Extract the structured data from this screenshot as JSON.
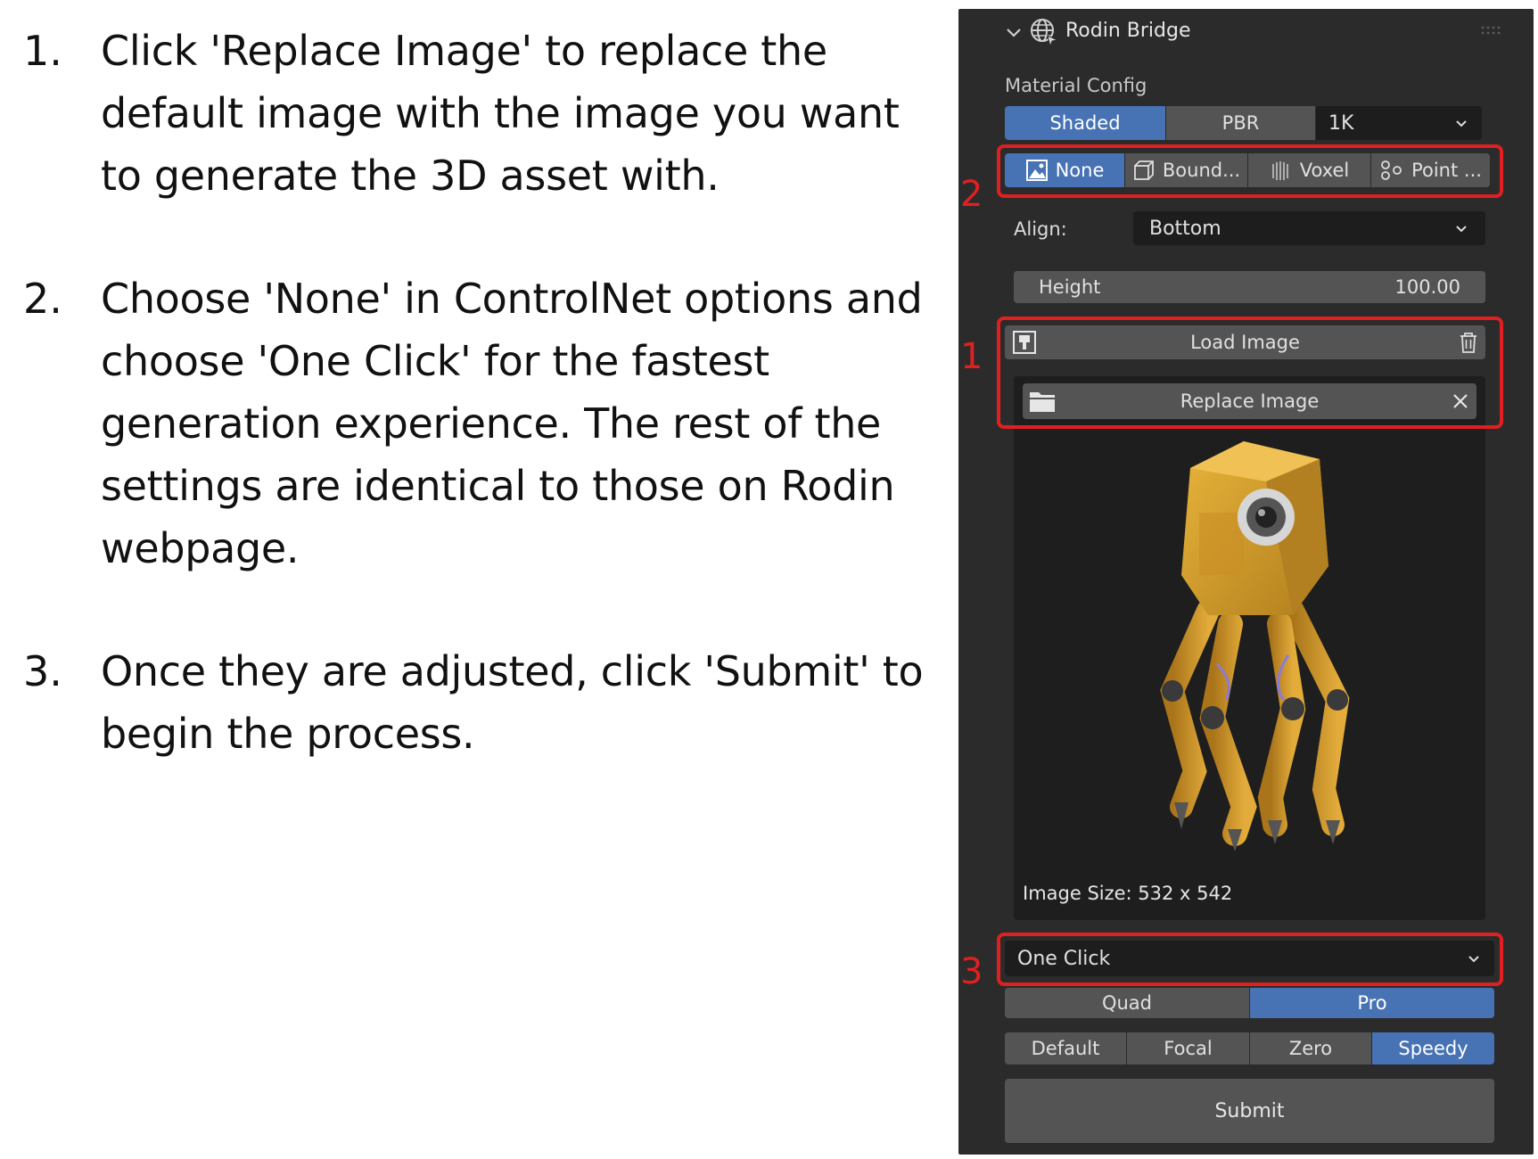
{
  "instructions": [
    {
      "num": "1.",
      "text": "Click 'Replace Image' to replace the default image with the image you want to generate the 3D asset with."
    },
    {
      "num": "2.",
      "text": "Choose 'None' in ControlNet options and choose 'One Click' for the fastest generation experience. The rest of the settings are identical to those on Rodin webpage."
    },
    {
      "num": "3.",
      "text": "Once they are adjusted, click 'Submit' to begin the process."
    }
  ],
  "panel": {
    "title": "Rodin Bridge",
    "material_label": "Material Config",
    "material_tabs": [
      "Shaded",
      "PBR"
    ],
    "material_active": "Shaded",
    "resolution_value": "1K",
    "controlnet": [
      "None",
      "Bound...",
      "Voxel",
      "Point ..."
    ],
    "controlnet_active": "None",
    "align_label": "Align:",
    "align_value": "Bottom",
    "height_label": "Height",
    "height_value": "100.00",
    "load_image_label": "Load Image",
    "replace_image_label": "Replace Image",
    "image_size_text": "Image Size: 532 x 542",
    "mode_value": "One Click",
    "quality_tabs": [
      "Quad",
      "Pro"
    ],
    "quality_active": "Pro",
    "style_tabs": [
      "Default",
      "Focal",
      "Zero",
      "Speedy"
    ],
    "style_active": "Speedy",
    "submit_label": "Submit"
  },
  "annotations": {
    "box1": "1",
    "box2": "2",
    "box3": "3"
  },
  "colors": {
    "accent": "#4772b3",
    "annotation_red": "#e02020",
    "panel_bg": "#2b2b2b"
  },
  "icons": {
    "header": "globe-icon",
    "none": "image-icon",
    "bound": "cube-icon",
    "voxel": "voxel-icon",
    "point": "points-icon",
    "load": "image-load-icon",
    "trash": "trash-icon",
    "folder": "folder-icon",
    "close": "close-icon"
  }
}
